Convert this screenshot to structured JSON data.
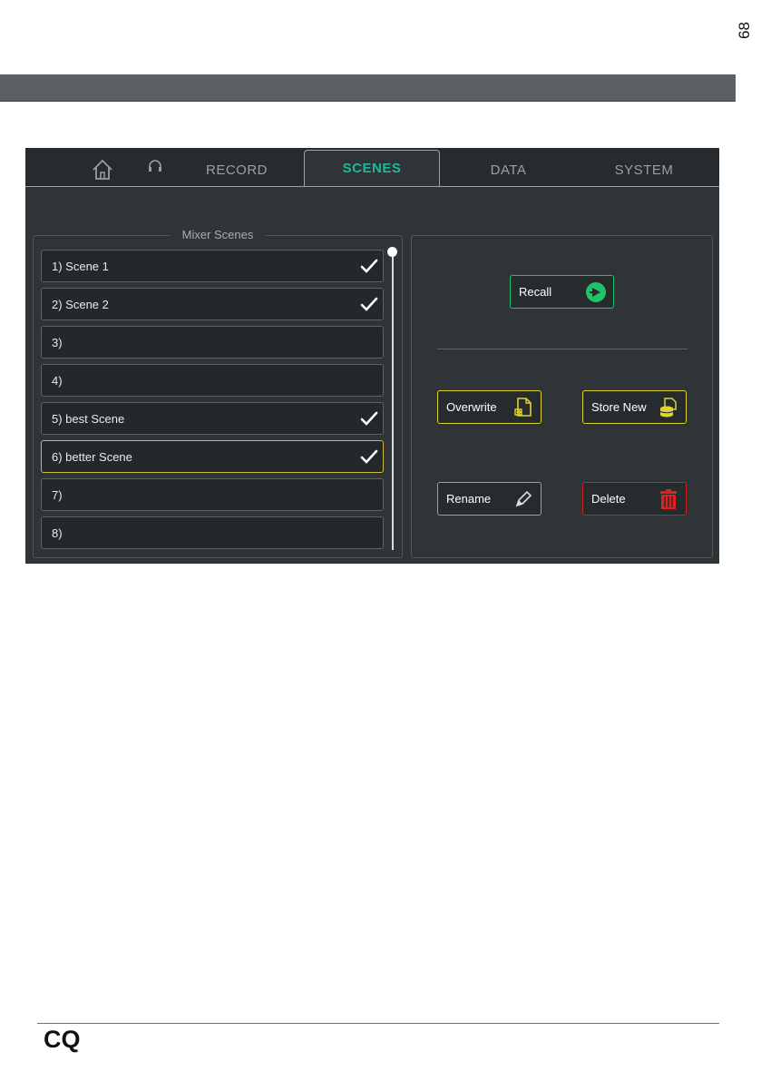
{
  "page": {
    "number": "68",
    "logo": "CQ"
  },
  "tabs": {
    "home_icon": "home-icon",
    "headphone_icon": "headphone-icon",
    "record": "RECORD",
    "scenes": "SCENES",
    "data": "DATA",
    "system": "SYSTEM"
  },
  "scenes_panel": {
    "title": "Mixer Scenes",
    "items": [
      {
        "label": "1) Scene 1",
        "stored": true
      },
      {
        "label": "2) Scene 2",
        "stored": true
      },
      {
        "label": "3)",
        "stored": false
      },
      {
        "label": "4)",
        "stored": false
      },
      {
        "label": "5) best Scene",
        "stored": true
      },
      {
        "label": "6) better Scene",
        "stored": true,
        "selected": true
      },
      {
        "label": "7)",
        "stored": false
      },
      {
        "label": "8)",
        "stored": false
      }
    ]
  },
  "actions": {
    "recall": "Recall",
    "overwrite": "Overwrite",
    "store_new": "Store New",
    "rename": "Rename",
    "delete": "Delete"
  },
  "colors": {
    "active_tab": "#1fb89d",
    "recall": "#1fc46a",
    "store": "#e1d233",
    "delete": "#cc2020",
    "selected": "#d4b73a"
  }
}
